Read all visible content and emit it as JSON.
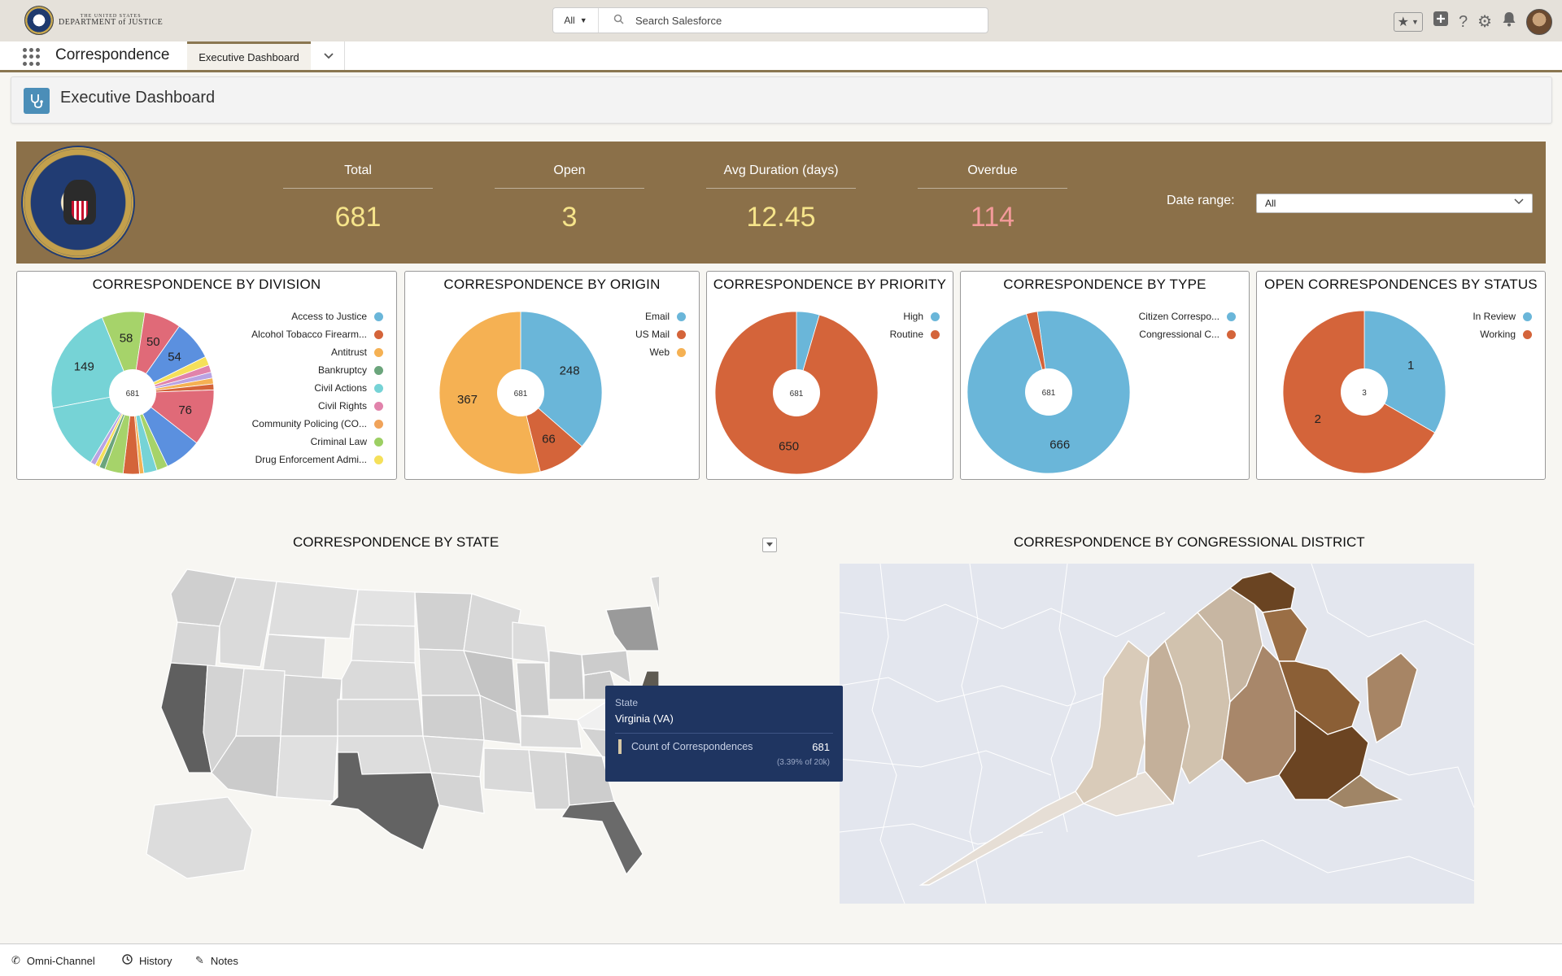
{
  "header": {
    "logo_small": "THE UNITED STATES",
    "logo_big": "DEPARTMENT of JUSTICE",
    "search_scope": "All",
    "search_placeholder": "Search Salesforce"
  },
  "nav": {
    "app_name": "Correspondence",
    "tab_label": "Executive Dashboard"
  },
  "page": {
    "title": "Executive Dashboard"
  },
  "kpis": {
    "total_label": "Total",
    "total_value": "681",
    "open_label": "Open",
    "open_value": "3",
    "avg_label": "Avg Duration (days)",
    "avg_value": "12.45",
    "overdue_label": "Overdue",
    "overdue_value": "114",
    "date_range_label": "Date range:",
    "date_range_value": "All"
  },
  "colors": {
    "blue": "#6ab6d9",
    "orange": "#d4643a",
    "yellow": "#f5b153",
    "green": "#6ba57c",
    "teal": "#76d3d6",
    "pink": "#e183ab",
    "banner": "#8b7049",
    "tooltip": "#1f3561"
  },
  "chart_data": [
    {
      "type": "pie",
      "title": "CORRESPONDENCE BY DIVISION",
      "center": "681",
      "legend": [
        "Access to Justice",
        "Alcohol Tobacco Firearm...",
        "Antitrust",
        "Bankruptcy",
        "Civil Actions",
        "Civil Rights",
        "Community Policing (CO...",
        "Criminal Law",
        "Drug Enforcement Admi..."
      ],
      "slices": [
        {
          "label": "",
          "value": 149,
          "color": "#76d3d6"
        },
        {
          "label": "",
          "value": 58,
          "color": "#a6d36a"
        },
        {
          "label": "",
          "value": 50,
          "color": "#e06a78"
        },
        {
          "label": "",
          "value": 54,
          "color": "#5b90df"
        },
        {
          "label": "",
          "value": 12,
          "color": "#f5e05a"
        },
        {
          "label": "",
          "value": 10,
          "color": "#e183ab"
        },
        {
          "label": "",
          "value": 8,
          "color": "#b9a3e3"
        },
        {
          "label": "",
          "value": 8,
          "color": "#f5b153"
        },
        {
          "label": "",
          "value": 8,
          "color": "#d4643a"
        },
        {
          "label": "",
          "value": 76,
          "color": "#e06a78"
        },
        {
          "label": "",
          "value": 50,
          "color": "#5b90df"
        },
        {
          "label": "",
          "value": 15,
          "color": "#a6d36a"
        },
        {
          "label": "",
          "value": 18,
          "color": "#76d3d6"
        },
        {
          "label": "",
          "value": 6,
          "color": "#f5b153"
        },
        {
          "label": "",
          "value": 22,
          "color": "#d4643a"
        },
        {
          "label": "",
          "value": 25,
          "color": "#a6d36a"
        },
        {
          "label": "",
          "value": 8,
          "color": "#6ba57c"
        },
        {
          "label": "",
          "value": 6,
          "color": "#f5e05a"
        },
        {
          "label": "",
          "value": 7,
          "color": "#b9a3e3"
        },
        {
          "label": "",
          "value": 91,
          "color": "#76d3d6"
        }
      ],
      "labels": [
        {
          "text": "149",
          "slice": 0
        },
        {
          "text": "58",
          "slice": 1
        },
        {
          "text": "50",
          "slice": 2
        },
        {
          "text": "54",
          "slice": 3
        },
        {
          "text": "76",
          "slice": 9
        }
      ]
    },
    {
      "type": "pie",
      "title": "CORRESPONDENCE BY ORIGIN",
      "center": "681",
      "legend": [
        "Email",
        "US Mail",
        "Web"
      ],
      "slices": [
        {
          "label": "248",
          "value": 248,
          "color": "#6ab6d9"
        },
        {
          "label": "66",
          "value": 66,
          "color": "#d4643a"
        },
        {
          "label": "367",
          "value": 367,
          "color": "#f5b153"
        }
      ]
    },
    {
      "type": "pie",
      "title": "CORRESPONDENCE BY PRIORITY",
      "center": "681",
      "legend": [
        "High",
        "Routine"
      ],
      "slices": [
        {
          "label": "",
          "value": 31,
          "color": "#6ab6d9"
        },
        {
          "label": "650",
          "value": 650,
          "color": "#d4643a"
        }
      ]
    },
    {
      "type": "pie",
      "title": "CORRESPONDENCE BY TYPE",
      "center": "681",
      "legend": [
        "Citizen Correspo...",
        "Congressional C..."
      ],
      "slices": [
        {
          "label": "666",
          "value": 666,
          "color": "#6ab6d9"
        },
        {
          "label": "",
          "value": 15,
          "color": "#d4643a"
        }
      ]
    },
    {
      "type": "pie",
      "title": "OPEN CORRESPONDENCES BY STATUS",
      "center": "3",
      "legend": [
        "In Review",
        "Working"
      ],
      "slices": [
        {
          "label": "1",
          "value": 1,
          "color": "#6ab6d9"
        },
        {
          "label": "2",
          "value": 2,
          "color": "#d4643a"
        }
      ]
    }
  ],
  "maps": {
    "state_title": "CORRESPONDENCE BY STATE",
    "district_title": "CORRESPONDENCE BY CONGRESSIONAL DISTRICT"
  },
  "tooltip": {
    "key": "State",
    "value": "Virginia (VA)",
    "metric": "Count of Correspondences",
    "count": "681",
    "pct": "(3.39% of 20k)"
  },
  "utility": {
    "omni": "Omni-Channel",
    "history": "History",
    "notes": "Notes"
  }
}
